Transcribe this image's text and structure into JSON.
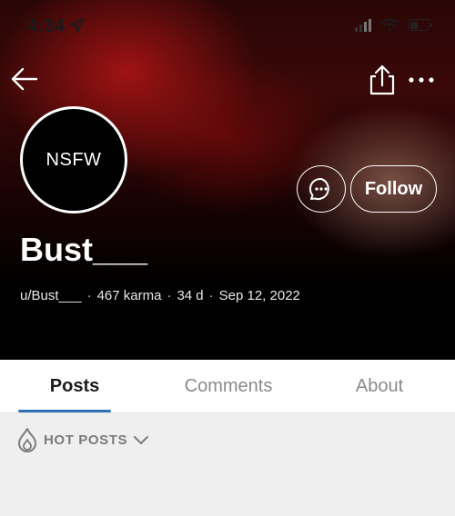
{
  "status_bar": {
    "time": "4:34"
  },
  "profile": {
    "avatar_text": "NSFW",
    "display_name": "Bust___",
    "username": "u/Bust___",
    "karma": "467 karma",
    "age": "34 d",
    "joined": "Sep 12, 2022",
    "separator": "·",
    "follow_label": "Follow"
  },
  "tabs": [
    {
      "label": "Posts",
      "active": true
    },
    {
      "label": "Comments",
      "active": false
    },
    {
      "label": "About",
      "active": false
    }
  ],
  "sort": {
    "label": "HOT POSTS"
  },
  "colors": {
    "accent": "#2f6fb8",
    "hero_dark": "#000000",
    "text_muted": "#8a8a8a"
  },
  "icons": [
    "navigation-arrow-icon",
    "signal-icon",
    "wifi-icon",
    "battery-icon",
    "back-arrow-icon",
    "share-icon",
    "more-icon",
    "chat-icon",
    "flame-icon",
    "chevron-down-icon"
  ]
}
